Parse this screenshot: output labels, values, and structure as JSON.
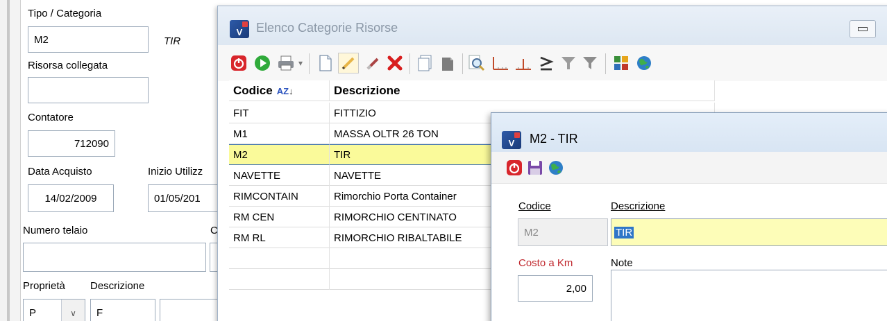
{
  "left_form": {
    "tipo_label": "Tipo / Categoria",
    "tipo_value": "M2",
    "tipo_desc": "TIR",
    "risorsa_label": "Risorsa collegata",
    "risorsa_value": "",
    "contatore_label": "Contatore",
    "contatore_value": "712090",
    "data_acquisto_label": "Data Acquisto",
    "data_acquisto_value": "14/02/2009",
    "inizio_label": "Inizio Utilizz",
    "inizio_value": "01/05/201",
    "telaio_label": "Numero telaio",
    "telaio_extra_label": "C",
    "telaio_value": "",
    "proprieta_label": "Proprietà",
    "descrizione_label": "Descrizione",
    "proprieta_value": "P",
    "descrizione_value": "F"
  },
  "list_window": {
    "title": "Elenco Categorie Risorse",
    "toolbar_icons": [
      "power-icon",
      "play-icon",
      "print-icon",
      "new-icon",
      "edit-icon",
      "eraser-icon",
      "delete-icon",
      "copy-icon",
      "paste-icon",
      "search-icon",
      "filter-bottom-icon",
      "filter-mid-icon",
      "greater-equal-icon",
      "funnel-icon",
      "funnel-clear-icon",
      "grid-settings-icon",
      "globe-icon"
    ],
    "columns": [
      "Codice",
      "Descrizione"
    ],
    "sort_indicator": "AZ",
    "rows": [
      {
        "codice": "FIT",
        "descrizione": "FITTIZIO"
      },
      {
        "codice": "M1",
        "descrizione": "MASSA OLTR 26 TON"
      },
      {
        "codice": "M2",
        "descrizione": "TIR"
      },
      {
        "codice": "NAVETTE",
        "descrizione": "NAVETTE"
      },
      {
        "codice": "RIMCONTAIN",
        "descrizione": "Rimorchio Porta Container"
      },
      {
        "codice": "RM CEN",
        "descrizione": "RIMORCHIO CENTINATO"
      },
      {
        "codice": "RM RL",
        "descrizione": "RIMORCHIO RIBALTABILE"
      }
    ],
    "selected_index": 2
  },
  "detail_window": {
    "title": "M2 - TIR",
    "codice_label": "Codice",
    "codice_value": "M2",
    "descrizione_label": "Descrizione",
    "descrizione_value": "TIR",
    "costo_label": "Costo a Km",
    "costo_value": "2,00",
    "note_label": "Note",
    "note_value": ""
  },
  "colors": {
    "selection_yellow": "#fafa9a",
    "required_label_red": "#c0272d",
    "title_bar": "#dde7f2"
  }
}
